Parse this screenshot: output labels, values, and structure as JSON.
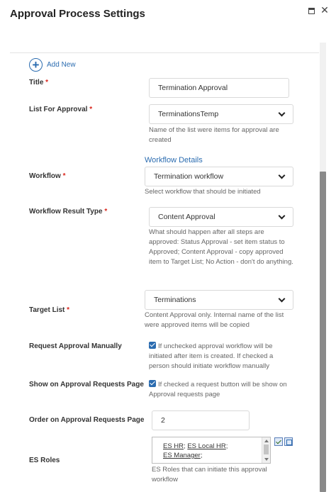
{
  "window": {
    "title": "Approval Process Settings",
    "maximize_icon": "maximize-icon",
    "close_glyph": "✕"
  },
  "add_new": {
    "label": "Add New",
    "icon": "plus-circle-icon"
  },
  "fields": {
    "title": {
      "label": "Title",
      "value": "Termination Approval"
    },
    "list_for_approval": {
      "label": "List For Approval",
      "value": "TerminationsTemp",
      "help": "Name of the list were items for approval are created"
    },
    "workflow_details_heading": "Workflow Details",
    "workflow": {
      "label": "Workflow",
      "value": "Termination workflow",
      "help": "Select workflow that should be initiated"
    },
    "workflow_result_type": {
      "label": "Workflow Result Type",
      "value": "Content Approval",
      "help": "What should happen after all steps are approved: Status Approval - set item status to Approved; Content Approval - copy approved item to Target List; No Action - don't do anything."
    },
    "target_list": {
      "label": "Target List",
      "value": "Terminations",
      "help": "Content Approval only. Internal name of the list were approved items will be copied"
    },
    "request_approval_manually": {
      "label": "Request Approval Manually",
      "checked": true,
      "help": "If unchecked approval workflow will be initiated after item is created. If checked a person should initiate workflow manually"
    },
    "show_on_requests_page": {
      "label": "Show on Approval Requests Page",
      "checked": true,
      "help": "If checked a request button will be show on Approval requests page"
    },
    "order_on_requests_page": {
      "label": "Order on Approval Requests Page",
      "value": "2"
    },
    "es_roles": {
      "label": "ES Roles",
      "roles": [
        "ES HR",
        "ES Local HR",
        "ES Manager"
      ],
      "help": "ES Roles that can initiate this approval workflow"
    }
  },
  "required_marker": "*"
}
